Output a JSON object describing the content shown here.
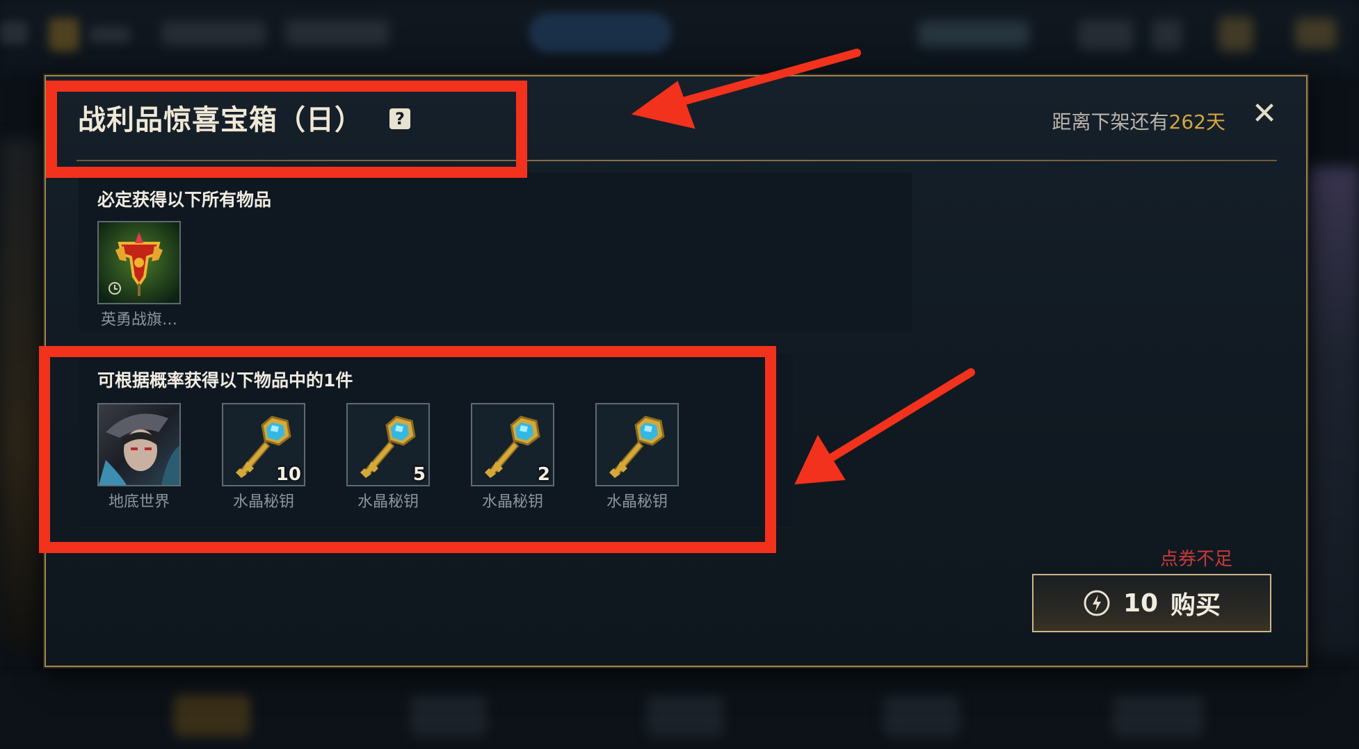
{
  "dialog": {
    "title": "战利品惊喜宝箱（日）",
    "help_icon": "help-icon",
    "countdown_prefix": "距离下架还有",
    "countdown_days": "262天",
    "close_icon": "close-icon"
  },
  "guaranteed": {
    "label": "必定获得以下所有物品",
    "items": [
      {
        "name": "英勇战旗…",
        "icon": "banner-icon",
        "timed": true
      }
    ]
  },
  "random": {
    "label": "可根据概率获得以下物品中的1件",
    "items": [
      {
        "name": "地底世界",
        "icon": "skin-portrait-icon",
        "count": ""
      },
      {
        "name": "水晶秘钥",
        "icon": "crystal-key-icon",
        "count": "10"
      },
      {
        "name": "水晶秘钥",
        "icon": "crystal-key-icon",
        "count": "5"
      },
      {
        "name": "水晶秘钥",
        "icon": "crystal-key-icon",
        "count": "2"
      },
      {
        "name": "水晶秘钥",
        "icon": "crystal-key-icon",
        "count": ""
      }
    ]
  },
  "purchase": {
    "warning": "点券不足",
    "price": "10",
    "label": "购买",
    "currency_icon": "coupon-icon"
  },
  "colors": {
    "accent_gold": "#d2a741",
    "warning_red": "#c73a3a",
    "annotation_red": "#f2321c",
    "frame_gold": "#a0864f"
  }
}
